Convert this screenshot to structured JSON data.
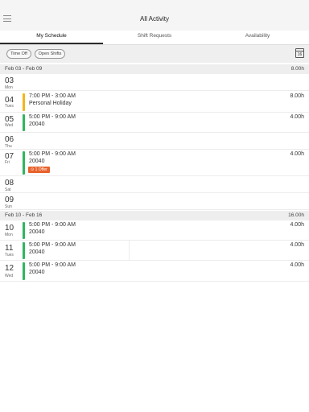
{
  "header": {
    "title": "All Activity"
  },
  "tabs": [
    {
      "label": "My Schedule",
      "active": true
    },
    {
      "label": "Shift Requests",
      "active": false
    },
    {
      "label": "Availability",
      "active": false
    }
  ],
  "filters": {
    "time_off": "Time Off",
    "open_shifts": "Open Shifts",
    "calendar_day": "16"
  },
  "colors": {
    "green": "#2fb55f",
    "yellow": "#f2b619",
    "offer": "#e8622c"
  },
  "weeks": [
    {
      "range": "Feb 03 - Feb 09",
      "hours": "8.00h"
    },
    {
      "range": "Feb 10 - Feb 16",
      "hours": "16.00h"
    }
  ],
  "days": [
    {
      "num": "03",
      "name": "Mon"
    },
    {
      "num": "04",
      "name": "Tues",
      "time": "7:00 PM - 3:00 AM",
      "desc": "Personal Holiday",
      "hours": "8.00h",
      "bar": "yellow"
    },
    {
      "num": "05",
      "name": "Wed",
      "time": "5:00 PM - 9:00 AM",
      "desc": "20040",
      "hours": "4.00h",
      "bar": "green"
    },
    {
      "num": "06",
      "name": "Thu"
    },
    {
      "num": "07",
      "name": "Fri",
      "time": "5:00 PM - 9:00 AM",
      "desc": "20040",
      "hours": "4.00h",
      "bar": "green",
      "offer": "1 Offer"
    },
    {
      "num": "08",
      "name": "Sat"
    },
    {
      "num": "09",
      "name": "Sun"
    },
    {
      "num": "10",
      "name": "Mon",
      "time": "5:00 PM - 9:00 AM",
      "desc": "20040",
      "hours": "4.00h",
      "bar": "green"
    },
    {
      "num": "11",
      "name": "Tues",
      "time": "5:00 PM - 9:00 AM",
      "desc": "20040",
      "hours": "4.00h",
      "bar": "green"
    },
    {
      "num": "12",
      "name": "Wed",
      "time": "5:00 PM - 9:00 AM",
      "desc": "20040",
      "hours": "4.00h",
      "bar": "green"
    }
  ]
}
